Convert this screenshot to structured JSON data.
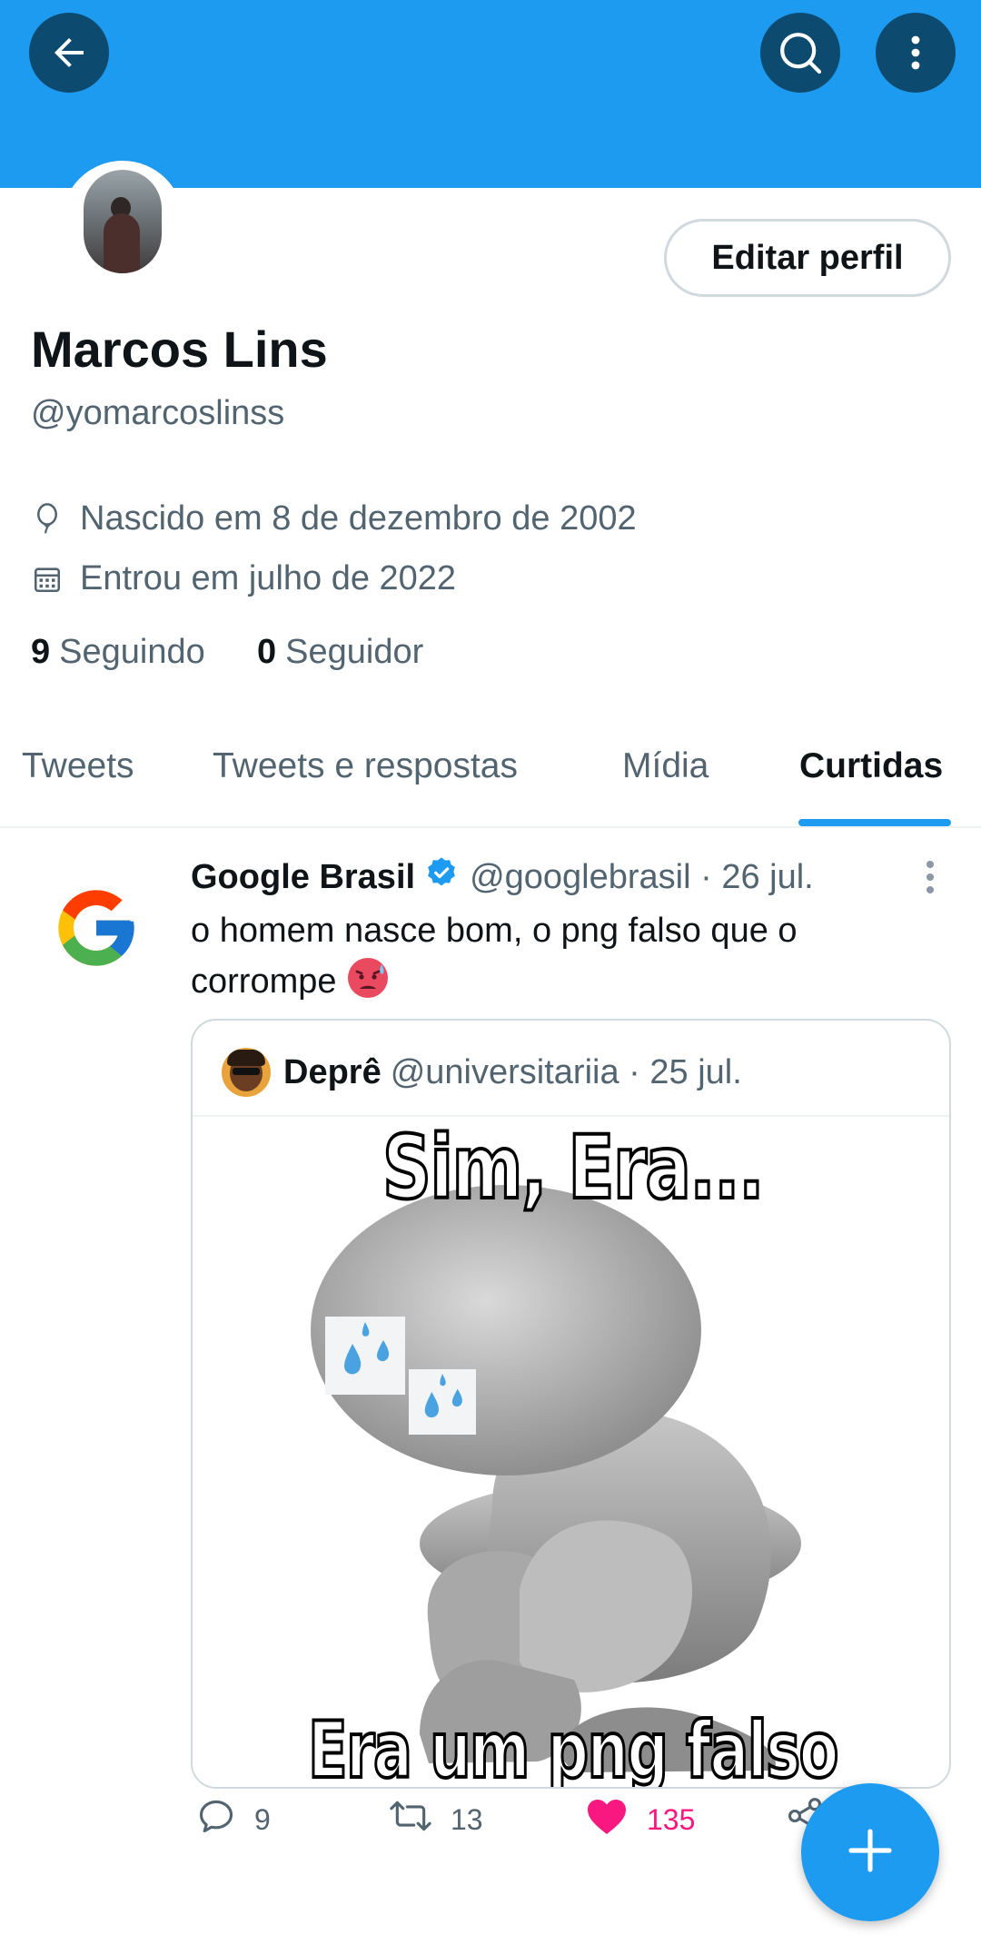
{
  "header": {
    "back_icon": "arrow-left-icon",
    "search_icon": "search-icon",
    "more_icon": "more-vertical-icon",
    "banner_color": "#1d9bf0"
  },
  "profile": {
    "edit_button": "Editar perfil",
    "name": "Marcos Lins",
    "handle": "@yomarcoslinss",
    "birth": "Nascido em 8 de dezembro de 2002",
    "joined": "Entrou em julho de 2022",
    "following_count": "9",
    "following_label": "Seguindo",
    "followers_count": "0",
    "followers_label": "Seguidor"
  },
  "tabs": {
    "items": [
      "Tweets",
      "Tweets e respostas",
      "Mídia",
      "Curtidas"
    ],
    "active": "Curtidas",
    "accent": "#1d9bf0"
  },
  "tweet": {
    "author": "Google Brasil",
    "verified": true,
    "handle_date": "@googlebrasil · 26 jul.",
    "text": "o homem nasce bom, o png falso que o corrompe",
    "quote": {
      "author": "Deprê",
      "handle_date": "@universitariia · 25 jul.",
      "meme_top": "Sim, Era...",
      "meme_bottom": "Era um png falso"
    },
    "actions": {
      "replies": "9",
      "retweets": "13",
      "likes": "135",
      "like_color": "#f91880"
    }
  },
  "fab": {
    "icon": "plus-icon"
  }
}
